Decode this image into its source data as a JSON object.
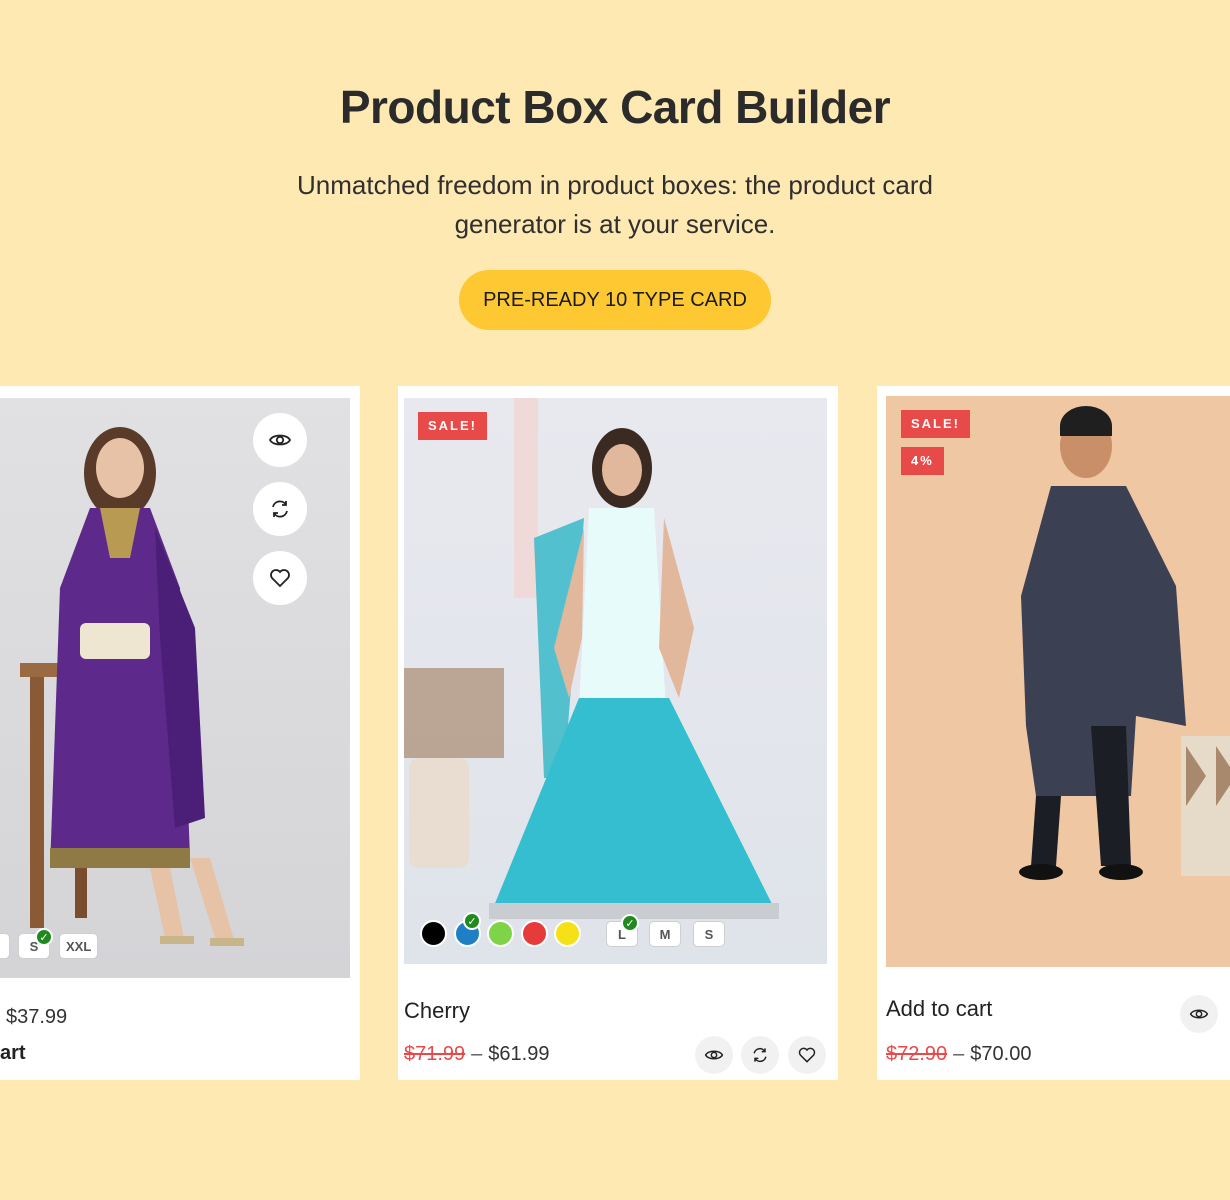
{
  "hero": {
    "title": "Product Box Card Builder",
    "subtitle_line1": "Unmatched freedom in product boxes: the product card",
    "subtitle_line2": "generator is at your service.",
    "cta_label": "PRE-READY 10 TYPE CARD"
  },
  "colors": {
    "background": "#ffe9b3",
    "cta": "#fec833",
    "sale_badge": "#e84a4a",
    "check": "#1f8b1f"
  },
  "cards": [
    {
      "sizes": [
        "L",
        "S",
        "XXL"
      ],
      "selected_size": "S",
      "price": "$37.99",
      "add_to_cart_partial": "art",
      "action_icons": [
        "eye-icon",
        "compare-icon",
        "heart-icon"
      ]
    },
    {
      "badge": "SALE!",
      "title": "Cherry",
      "old_price": "$71.99",
      "dash": "–",
      "price": "$61.99",
      "swatches": [
        "#000000",
        "#1e7fc4",
        "#7ed348",
        "#e53b3b",
        "#f5e116"
      ],
      "selected_swatch": "#1e7fc4",
      "sizes": [
        "L",
        "M",
        "S"
      ],
      "selected_size": "L",
      "action_icons": [
        "eye-icon",
        "compare-icon",
        "heart-icon"
      ]
    },
    {
      "badge": "SALE!",
      "discount": "4%",
      "title": "Add to cart",
      "old_price": "$72.90",
      "dash": "–",
      "price": "$70.00",
      "action_icons": [
        "eye-icon"
      ]
    }
  ]
}
